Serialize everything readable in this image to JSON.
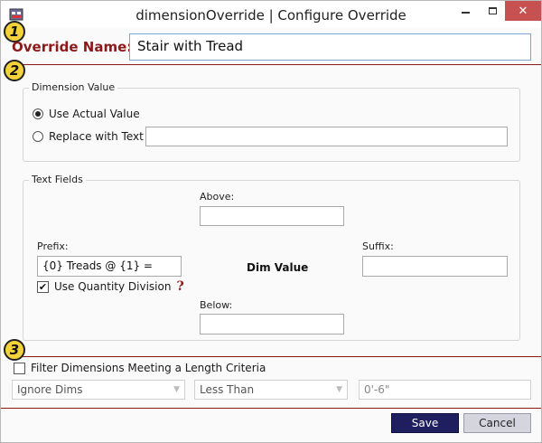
{
  "window": {
    "title": "dimensionOverride | Configure Override",
    "min_glyph": "",
    "close_glyph": "✕"
  },
  "steps": [
    "1",
    "2",
    "3"
  ],
  "override": {
    "label": "Override Name:",
    "value": "Stair with Tread"
  },
  "dimension_value": {
    "group_title": "Dimension Value",
    "option_actual": "Use Actual Value",
    "option_replace": "Replace with Text",
    "selected": "Use Actual Value",
    "replace_text": ""
  },
  "text_fields": {
    "group_title": "Text Fields",
    "above_label": "Above:",
    "above_value": "",
    "prefix_label": "Prefix:",
    "prefix_value": "{0} Treads @ {1} =",
    "dim_value_label": "Dim Value",
    "suffix_label": "Suffix:",
    "suffix_value": "",
    "below_label": "Below:",
    "below_value": "",
    "use_quantity_division_label": "Use Quantity Division",
    "use_quantity_division_checked": true,
    "help_glyph": "?"
  },
  "filter": {
    "checkbox_label": "Filter Dimensions Meeting a Length Criteria",
    "checked": false,
    "mode_value": "Ignore Dims",
    "comparison_value": "Less Than",
    "length_value": "0'-6\""
  },
  "buttons": {
    "save": "Save",
    "cancel": "Cancel"
  },
  "colors": {
    "accent": "#8b1a1a",
    "badge": "#f3d23a",
    "save_button": "#1f1f5f"
  }
}
